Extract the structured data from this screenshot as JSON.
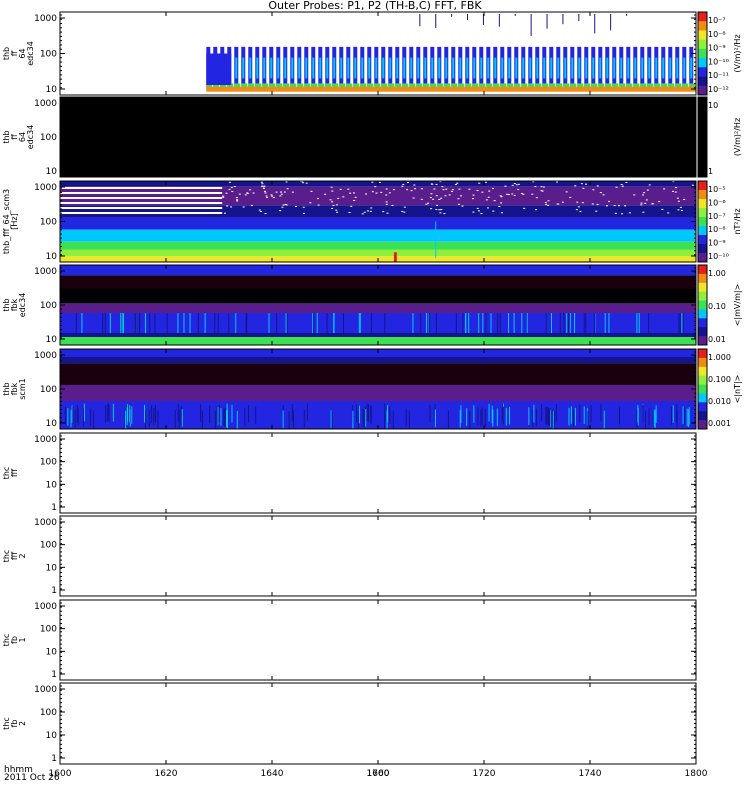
{
  "title": "Outer Probes: P1, P2 (TH-B,C) FFT, FBK",
  "colors": {
    "dark": "#1a000e",
    "black": "#000000",
    "blue": "#2326e0",
    "navy": "#14148c",
    "purple": "#5a1e8c",
    "cyan": "#00c8ff",
    "green": "#3ce050",
    "lime": "#8cf03c",
    "yellow": "#f0e628",
    "orange": "#f08c14",
    "red": "#e61e1e"
  },
  "footer": {
    "line1": "hhmm",
    "line2": "2011 Oct 26"
  },
  "chart_data": {
    "type": "heatmap",
    "x_axis": {
      "range": [
        1600,
        1800
      ],
      "ticks": [
        "1600",
        "1620",
        "1640",
        "1660",
        "1700",
        "1720",
        "1740",
        "1800"
      ]
    },
    "panels": [
      {
        "id": "p1",
        "ylabel": [
          "thb",
          "ff",
          "64",
          "edc34"
        ],
        "yticks": [
          "1000",
          "100",
          "10"
        ],
        "yscale": "log",
        "cbar": {
          "ticks": [
            "10⁻⁷",
            "10⁻⁸",
            "10⁻⁹",
            "10⁻¹⁰",
            "10⁻¹¹",
            "10⁻¹²"
          ],
          "unit": "(V/m)²/Hz"
        },
        "data_from": 1646,
        "style": "ff_e"
      },
      {
        "id": "p2",
        "ylabel": [
          "thb",
          "ff",
          "64",
          "edc34"
        ],
        "yticks": [
          "1000",
          "100",
          "10"
        ],
        "yscale": "log",
        "cbar": {
          "ticks": [
            "10",
            "1"
          ],
          "unit": "(V/m)²/Hz"
        },
        "data_from": 1600,
        "style": "black"
      },
      {
        "id": "p3",
        "ylabel": [
          "thb_fff_64_scm3",
          "[Hz]"
        ],
        "yticks": [
          "1000",
          "100",
          "10"
        ],
        "yscale": "log",
        "cbar": {
          "ticks": [
            "10⁻⁵",
            "10⁻⁶",
            "10⁻⁷",
            "10⁻⁸",
            "10⁻⁹",
            "10⁻¹⁰"
          ],
          "unit": "nT²/Hz"
        },
        "data_from": 1600,
        "style": "ff_b"
      },
      {
        "id": "p4",
        "ylabel": [
          "thb",
          "fbk",
          "edc34"
        ],
        "yticks": [
          "1000",
          "100",
          "10"
        ],
        "yscale": "log",
        "cbar": {
          "ticks": [
            "1.00",
            "0.10",
            "0.01"
          ],
          "unit": "<|mV/m|>"
        },
        "data_from": 1600,
        "style": "fbk_e"
      },
      {
        "id": "p5",
        "ylabel": [
          "thb",
          "fbk",
          "scm1"
        ],
        "yticks": [
          "1000",
          "100",
          "10"
        ],
        "yscale": "log",
        "cbar": {
          "ticks": [
            "1.000",
            "0.100",
            "0.010",
            "0.001"
          ],
          "unit": "<|nT|>"
        },
        "data_from": 1600,
        "style": "fbk_b"
      },
      {
        "id": "p6",
        "ylabel": [
          "thc",
          "fff"
        ],
        "yticks": [
          "1000",
          "100",
          "10",
          "1"
        ],
        "yscale": "log",
        "cbar": null,
        "data_from": null,
        "style": "empty"
      },
      {
        "id": "p7",
        "ylabel": [
          "thc",
          "fff",
          "2"
        ],
        "yticks": [
          "1000",
          "100",
          "10",
          "1"
        ],
        "yscale": "log",
        "cbar": null,
        "data_from": null,
        "style": "empty"
      },
      {
        "id": "p8",
        "ylabel": [
          "thc",
          "fb",
          "1"
        ],
        "yticks": [
          "1000",
          "100",
          "10",
          "1"
        ],
        "yscale": "log",
        "cbar": null,
        "data_from": null,
        "style": "empty"
      },
      {
        "id": "p9",
        "ylabel": [
          "thc",
          "fb",
          "2"
        ],
        "yticks": [
          "1000",
          "100",
          "10",
          "1"
        ],
        "yscale": "log",
        "cbar": null,
        "data_from": null,
        "style": "empty"
      }
    ]
  }
}
